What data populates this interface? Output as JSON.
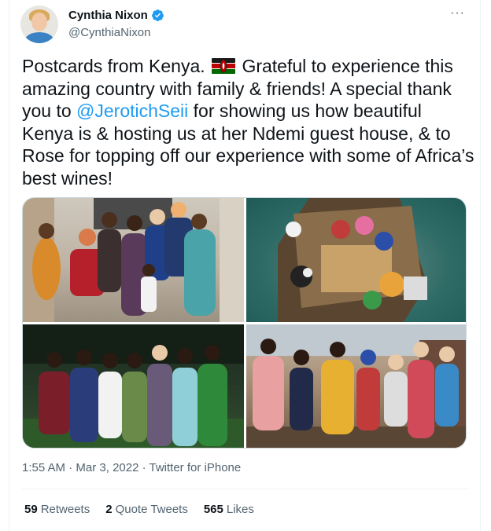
{
  "author": {
    "name": "Cynthia Nixon",
    "handle": "@CynthiaNixon"
  },
  "more_label": "···",
  "tweet": {
    "text_part1": "Postcards from Kenya.",
    "text_part2": "Grateful to experience this amazing country with family & friends! A special thank you to",
    "mention": "@JerotichSeii",
    "text_part3": "for showing us how beautiful Kenya is & hosting us at her Ndemi guest house, & to Rose for topping off our experience with some of Africa’s best wines!"
  },
  "meta": {
    "time": "1:55 AM",
    "sep1": " · ",
    "date": "Mar 3, 2022",
    "sep2": " · ",
    "source": "Twitter for iPhone"
  },
  "stats": {
    "retweets_count": "59",
    "retweets_label": "Retweets",
    "quotes_count": "2",
    "quotes_label": "Quote Tweets",
    "likes_count": "565",
    "likes_label": "Likes"
  },
  "colors": {
    "accent": "#1d9bf0",
    "secondary_text": "#536471",
    "primary_text": "#0f1419"
  }
}
